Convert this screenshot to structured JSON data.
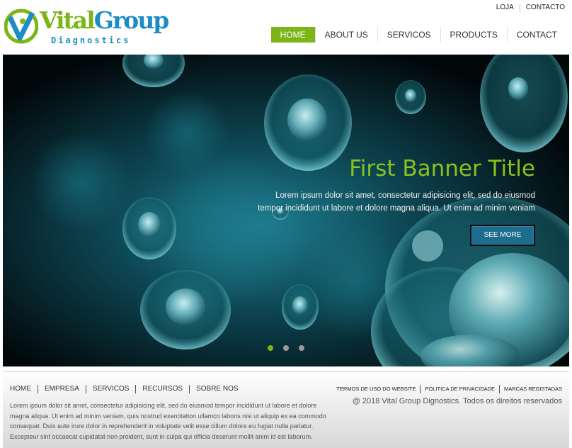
{
  "brand": {
    "word1": "Vital",
    "word2": "Group",
    "tagline": "Diagnostics"
  },
  "top_links": [
    "LOJA",
    "CONTACTO"
  ],
  "nav": [
    {
      "label": "HOME",
      "active": true
    },
    {
      "label": "ABOUT US",
      "active": false
    },
    {
      "label": "SERVICOS",
      "active": false
    },
    {
      "label": "PRODUCTS",
      "active": false
    },
    {
      "label": "CONTACT",
      "active": false
    }
  ],
  "banner": {
    "title": "First Banner Title",
    "text": "Lorem ipsum dolor sit amet, consectetur adipisicing elit, sed do eiusmod tempor incididunt ut labore et dolore magna aliqua. Ut enim ad minim veniam",
    "button": "SEE MORE",
    "slides": 3,
    "active_slide": 1
  },
  "footer": {
    "nav": [
      "HOME",
      "EMPRESA",
      "SERVICOS",
      "RECURSOS",
      "SOBRE NOS"
    ],
    "text": "Lorem ipsum dolor sit amet, consectetur adipisicing elit, sed do eiusmod tempor incididunt ut labore et dolore magna aliqua. Ut enim ad minim veniam, quis nostrud exercitation ullamco laboris nisi ut aliquip ex ea commodo consequat. Duis aute irure dolor in reprehenderit in voluptate velit esse cillum dolore eu fugiat nulla pariatur. Excepteur sint occaecat cupidatat non proident, sunt in culpa qui officia deserunt mollit anim id est laborum.",
    "legal": [
      "TERMOS DE USO DO WEBSITE",
      "POLITICA DE PRIVACIDADE",
      "MARCAS REGISTADAS"
    ],
    "copyright": "@ 2018 Vital Group Dignostics. Todos os direitos reservados"
  },
  "colors": {
    "accent_green": "#7cb518",
    "brand_blue": "#1d8cc4",
    "button_blue": "#1e6d8c"
  }
}
